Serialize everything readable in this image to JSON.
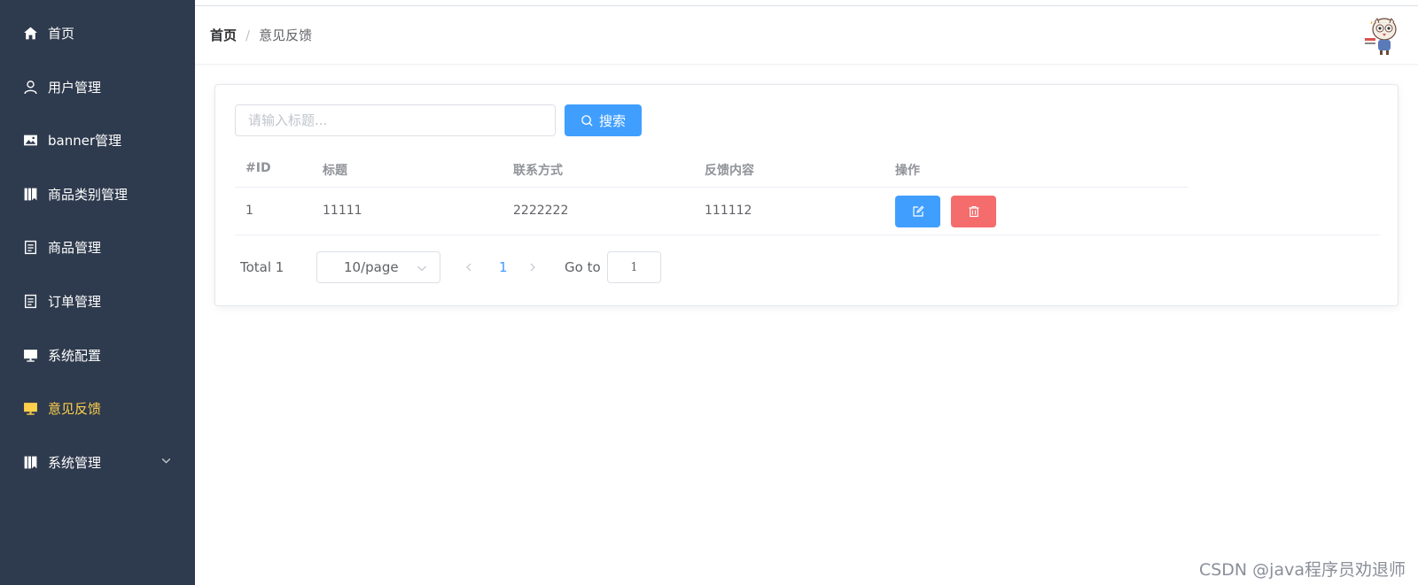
{
  "sidebar": {
    "background": "#2e3a4d",
    "active_color": "#ffd04b",
    "items": [
      {
        "label": "首页",
        "icon": "home-icon"
      },
      {
        "label": "用户管理",
        "icon": "user-icon"
      },
      {
        "label": "banner管理",
        "icon": "picture-icon"
      },
      {
        "label": "商品类别管理",
        "icon": "collection-icon"
      },
      {
        "label": "商品管理",
        "icon": "document-icon"
      },
      {
        "label": "订单管理",
        "icon": "document-icon"
      },
      {
        "label": "系统配置",
        "icon": "monitor-icon"
      },
      {
        "label": "意见反馈",
        "icon": "monitor-icon",
        "active": true
      },
      {
        "label": "系统管理",
        "icon": "collection-icon",
        "expandable": true
      }
    ]
  },
  "header": {
    "breadcrumb": {
      "home": "首页",
      "separator": "/",
      "current": "意见反馈"
    },
    "avatar": "avatar-cartoon-owl"
  },
  "search": {
    "placeholder": "请输入标题...",
    "value": "",
    "button_label": "搜索",
    "button_icon": "search-icon",
    "button_color": "#409eff"
  },
  "table": {
    "columns": [
      "#ID",
      "标题",
      "联系方式",
      "反馈内容",
      "操作"
    ],
    "rows": [
      {
        "id": "1",
        "title": "11111",
        "contact": "2222222",
        "content": "111112",
        "actions": [
          "edit-icon",
          "delete-icon"
        ]
      }
    ],
    "edit_color": "#409eff",
    "delete_color": "#f56c6c"
  },
  "pagination": {
    "total_label": "Total 1",
    "page_size": "10/page",
    "current_page": "1",
    "goto_label": "Go to",
    "goto_value": "1"
  },
  "watermark": "CSDN @java程序员劝退师"
}
